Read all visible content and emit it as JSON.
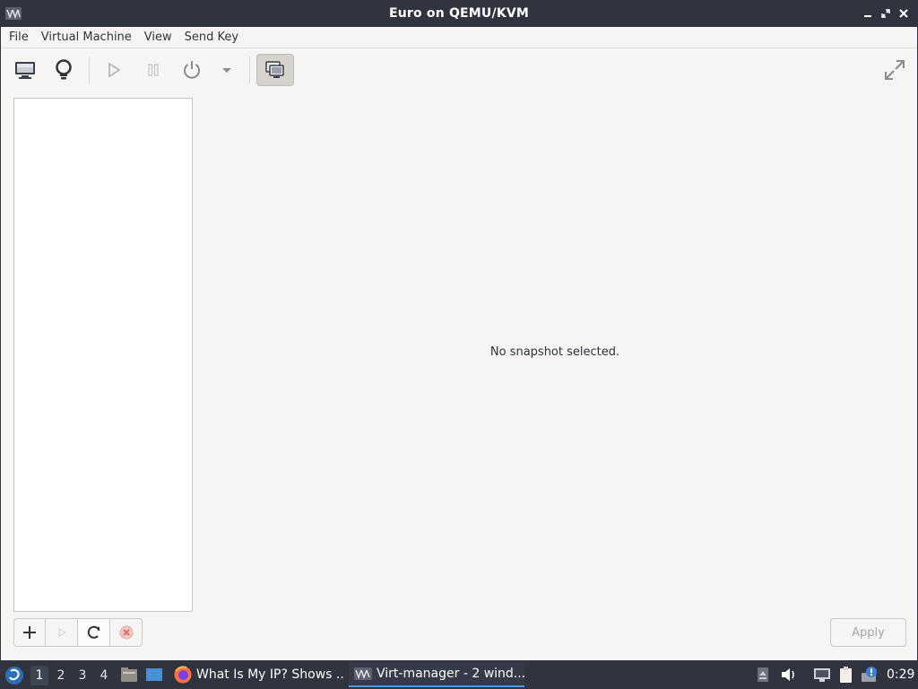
{
  "window": {
    "title": "Euro on QEMU/KVM",
    "controls": [
      "minimize",
      "restore",
      "close"
    ]
  },
  "menubar": {
    "items": [
      {
        "label": "File"
      },
      {
        "label": "Virtual Machine"
      },
      {
        "label": "View"
      },
      {
        "label": "Send Key"
      }
    ]
  },
  "toolbar": {
    "icons": [
      "monitor-icon",
      "lightbulb-icon",
      "play-icon",
      "pause-icon",
      "power-icon",
      "dropdown-arrow-icon",
      "snapshots-icon",
      "fullscreen-icon"
    ]
  },
  "snapshots": {
    "items": [],
    "empty_message": "No snapshot selected."
  },
  "bottom_actions": {
    "apply_label": "Apply"
  },
  "taskbar": {
    "workspaces": [
      "1",
      "2",
      "3",
      "4"
    ],
    "current_workspace": "1",
    "tasks": [
      {
        "label": "What Is My IP? Shows ...",
        "icon": "firefox-icon",
        "active": false
      },
      {
        "label": "Virt-manager - 2 wind...",
        "icon": "virt-manager-icon",
        "active": true
      }
    ],
    "clock": "0:29"
  },
  "colors": {
    "titlebar": "#2f343f",
    "window_bg": "#f6f5f4",
    "accent": "#5294e2"
  }
}
